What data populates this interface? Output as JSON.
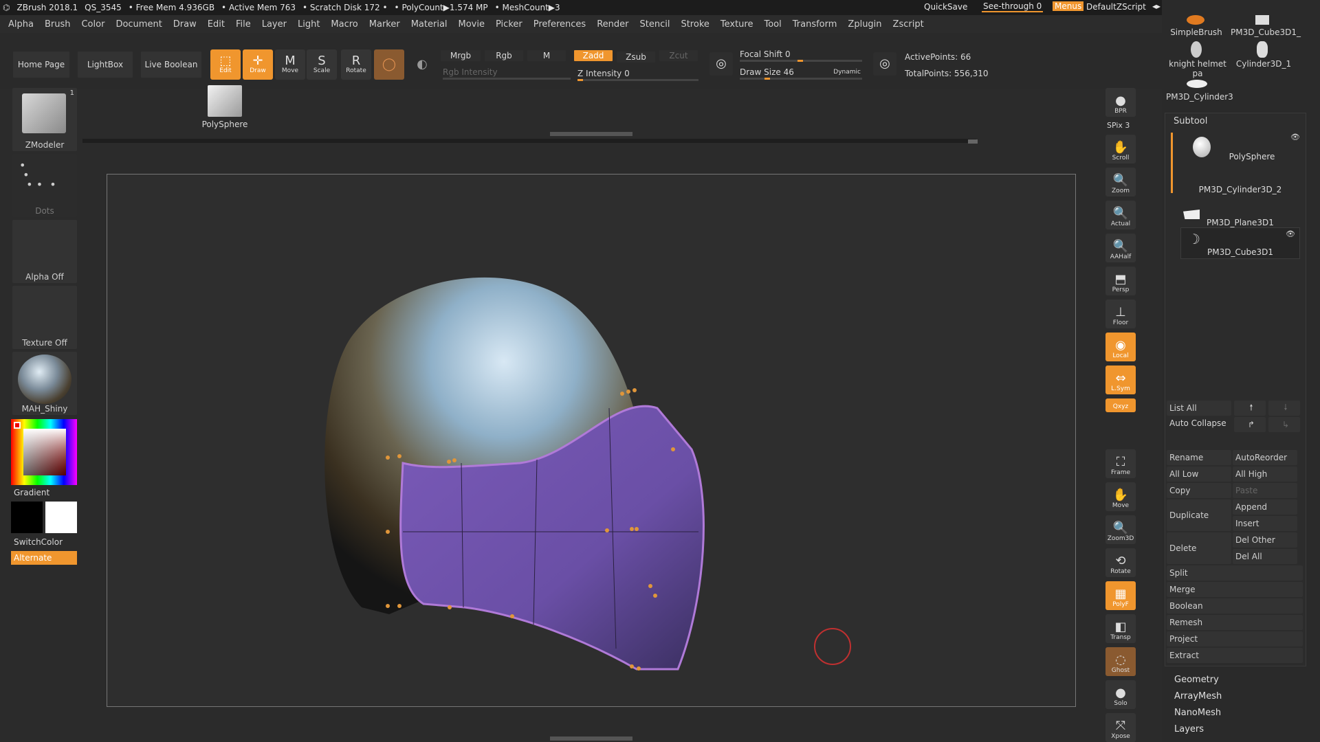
{
  "titlebar": {
    "app": "ZBrush 2018.1",
    "doc": "QS_3545",
    "free_mem": "• Free Mem 4.936GB",
    "active_mem": "• Active Mem 763",
    "scratch": "• Scratch Disk 172 •",
    "polycount": "• PolyCount▶1.574 MP",
    "meshcount": "• MeshCount▶3",
    "quicksave": "QuickSave",
    "seethrough": "See-through 0",
    "menus": "Menus",
    "script": "DefaultZScript"
  },
  "menubar": [
    "Alpha",
    "Brush",
    "Color",
    "Document",
    "Draw",
    "Edit",
    "File",
    "Layer",
    "Light",
    "Macro",
    "Marker",
    "Material",
    "Movie",
    "Picker",
    "Preferences",
    "Render",
    "Stencil",
    "Stroke",
    "Texture",
    "Tool",
    "Transform",
    "Zplugin",
    "Zscript"
  ],
  "toolbar": {
    "home": "Home Page",
    "lightbox": "LightBox",
    "liveboolean": "Live Boolean",
    "edit": "Edit",
    "draw": "Draw",
    "move": "Move",
    "scale": "Scale",
    "rotate": "Rotate",
    "mrgb": "Mrgb",
    "rgb": "Rgb",
    "m": "M",
    "zadd": "Zadd",
    "zsub": "Zsub",
    "zcut": "Zcut",
    "rgb_intensity": "Rgb Intensity",
    "z_intensity": "Z Intensity 0",
    "focal_shift": "Focal Shift 0",
    "draw_size": "Draw Size 46",
    "dynamic": "Dynamic",
    "active_points": "ActivePoints: 66",
    "total_points": "TotalPoints: 556,310",
    "polysphere": "PolySphere"
  },
  "left": {
    "zmodeler": "ZModeler",
    "zmodeler_count": "1",
    "dots": "Dots",
    "alpha": "Alpha Off",
    "texture": "Texture Off",
    "material": "MAH_Shiny",
    "gradient": "Gradient",
    "switchcolor": "SwitchColor",
    "alternate": "Alternate"
  },
  "righttools": [
    "BPR",
    "SPix 3",
    "Scroll",
    "Zoom",
    "Actual",
    "AAHalf",
    "Persp",
    "Floor",
    "Local",
    "L.Sym",
    "Qxyz",
    "Frame",
    "Move",
    "Zoom3D",
    "Rotate",
    "PolyF",
    "Transp",
    "Ghost",
    "Solo",
    "Xpose"
  ],
  "rightpanel": {
    "thumbs": [
      "SimpleBrush",
      "PM3D_Cube3D1_",
      "knight helmet pa",
      "Cylinder3D_1",
      "PM3D_Cylinder3"
    ],
    "subtool_title": "Subtool",
    "subtools": [
      "PolySphere",
      "PM3D_Cylinder3D_2",
      "PM3D_Plane3D1",
      "PM3D_Cube3D1"
    ],
    "list_all": "List All",
    "auto_collapse": "Auto Collapse",
    "rename": "Rename",
    "autoreorder": "AutoReorder",
    "all_low": "All Low",
    "all_high": "All High",
    "copy": "Copy",
    "paste": "Paste",
    "duplicate": "Duplicate",
    "append": "Append",
    "insert": "Insert",
    "delete": "Delete",
    "del_other": "Del Other",
    "del_all": "Del All",
    "split": "Split",
    "merge": "Merge",
    "boolean": "Boolean",
    "remesh": "Remesh",
    "project": "Project",
    "extract": "Extract",
    "sections": [
      "Geometry",
      "ArrayMesh",
      "NanoMesh",
      "Layers"
    ]
  },
  "colors": {
    "accent": "#f0962e",
    "bg": "#2b2b2b"
  }
}
